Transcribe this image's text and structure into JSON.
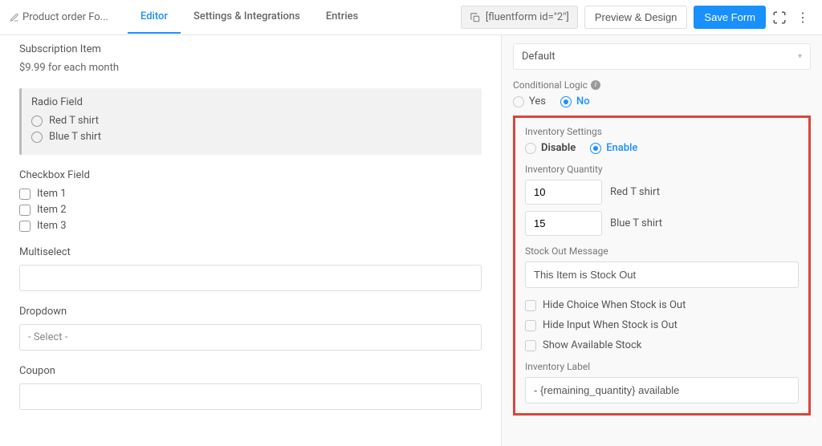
{
  "header": {
    "form_title": "Product order Fo...",
    "tabs": {
      "editor": "Editor",
      "settings": "Settings & Integrations",
      "entries": "Entries"
    },
    "shortcode": "[fluentform id=\"2\"]",
    "preview_btn": "Preview & Design",
    "save_btn": "Save Form"
  },
  "canvas": {
    "subscription": {
      "label": "Subscription Item",
      "price_line": "$9.99 for each month"
    },
    "radio_field": {
      "label": "Radio Field",
      "options": [
        "Red T shirt",
        "Blue T shirt"
      ]
    },
    "checkbox_field": {
      "label": "Checkbox Field",
      "options": [
        "Item 1",
        "Item 2",
        "Item 3"
      ]
    },
    "multiselect": {
      "label": "Multiselect"
    },
    "dropdown": {
      "label": "Dropdown",
      "placeholder": "- Select -"
    },
    "coupon": {
      "label": "Coupon"
    }
  },
  "sidebar": {
    "default_select": "Default",
    "conditional_logic": {
      "label": "Conditional Logic",
      "yes": "Yes",
      "no": "No"
    },
    "inventory_settings": {
      "label": "Inventory Settings",
      "disable": "Disable",
      "enable": "Enable"
    },
    "inventory_quantity": {
      "label": "Inventory Quantity",
      "rows": [
        {
          "qty": "10",
          "name": "Red T shirt"
        },
        {
          "qty": "15",
          "name": "Blue T shirt"
        }
      ]
    },
    "stock_out": {
      "label": "Stock Out Message",
      "value": "This Item is Stock Out"
    },
    "options": {
      "hide_choice": "Hide Choice When Stock is Out",
      "hide_input": "Hide Input When Stock is Out",
      "show_available": "Show Available Stock"
    },
    "inventory_label": {
      "label": "Inventory Label",
      "value": "- {remaining_quantity} available"
    }
  }
}
